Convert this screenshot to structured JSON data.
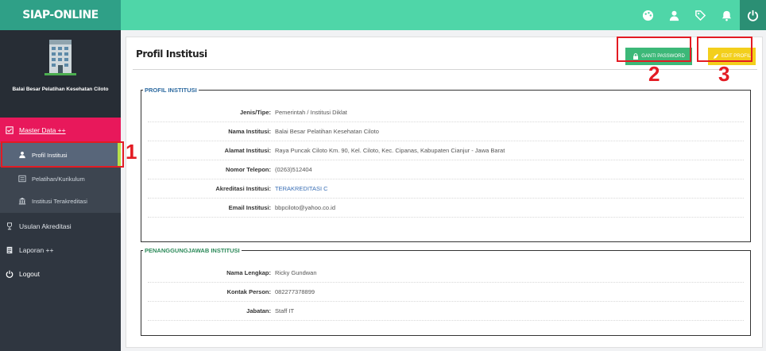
{
  "app": {
    "brand": "SIAP-ONLINE"
  },
  "topbar": {
    "icons": [
      "palette-icon",
      "user-icon",
      "tag-icon",
      "bell-icon",
      "power-icon"
    ]
  },
  "sidebar": {
    "institution_name": "Balai Besar Pelatihan Kesehatan Ciloto",
    "menu": {
      "master": "Master Data ++",
      "profil": "Profil Institusi",
      "pelatihan": "Pelatihan/Kurikulum",
      "terakreditasi": "Institusi Terakreditasi",
      "usulan": "Usulan Akreditasi",
      "laporan": "Laporan ++",
      "logout": "Logout"
    }
  },
  "main": {
    "title": "Profil Institusi",
    "buttons": {
      "change_password": "GANTI PASSWORD",
      "edit": "EDIT PROFIL"
    },
    "profil_section": {
      "legend": "PROFIL INSTITUSI",
      "rows": [
        {
          "label": "Jenis/Tipe:",
          "value": "Pemerintah / Institusi Diklat"
        },
        {
          "label": "Nama Institusi:",
          "value": "Balai Besar Pelatihan Kesehatan Ciloto"
        },
        {
          "label": "Alamat Institusi:",
          "value": "Raya Puncak Ciloto Km. 90, Kel. Ciloto, Kec. Cipanas, Kabupaten Cianjur - Jawa Barat"
        },
        {
          "label": "Nomor Telepon:",
          "value": "(0263)512404"
        },
        {
          "label": "Akreditasi Institusi:",
          "value": "TERAKREDITASI C"
        },
        {
          "label": "Email Institusi:",
          "value": "bbpciloto@yahoo.co.id"
        }
      ]
    },
    "pj_section": {
      "legend": "PENANGGUNGJAWAB INSTITUSI",
      "rows": [
        {
          "label": "Nama Lengkap:",
          "value": "Ricky Gundwan"
        },
        {
          "label": "Kontak Person:",
          "value": "082277378899"
        },
        {
          "label": "Jabatan:",
          "value": "Staff IT"
        }
      ]
    }
  },
  "annotations": [
    "1",
    "2",
    "3"
  ],
  "colors": {
    "topbar": "#4fd6a8",
    "brand": "#2fa087",
    "sidebar": "#2f3640",
    "active_menu": "#e8185b",
    "annotation": "#e31b23",
    "btn_password": "#3cb878",
    "btn_edit": "#f3cf1c"
  }
}
